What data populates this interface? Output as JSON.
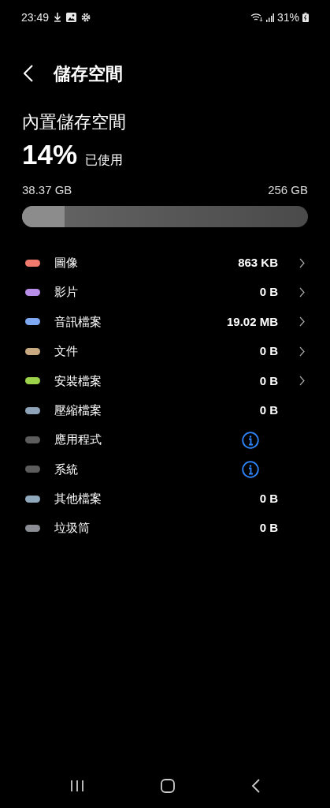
{
  "status_bar": {
    "time": "23:49",
    "battery": "31%"
  },
  "header": {
    "title": "儲存空間"
  },
  "storage": {
    "title": "內置儲存空間",
    "percent": "14%",
    "percent_label": "已使用",
    "used": "38.37 GB",
    "total": "256 GB",
    "level": 0.15
  },
  "categories": [
    {
      "label": "圖像",
      "color": "#f07a6e",
      "kind": "size",
      "size": "863 KB",
      "chevron": true
    },
    {
      "label": "影片",
      "color": "#b98ee8",
      "kind": "size",
      "size": "0 B",
      "chevron": true
    },
    {
      "label": "音訊檔案",
      "color": "#7fa8f2",
      "kind": "size",
      "size": "19.02 MB",
      "chevron": true
    },
    {
      "label": "文件",
      "color": "#c8a982",
      "kind": "size",
      "size": "0 B",
      "chevron": true
    },
    {
      "label": "安裝檔案",
      "color": "#9dd34a",
      "kind": "size",
      "size": "0 B",
      "chevron": true
    },
    {
      "label": "壓縮檔案",
      "color": "#8fa3b8",
      "kind": "size",
      "size": "0 B",
      "chevron": false
    },
    {
      "label": "應用程式",
      "color": "#5c5c5c",
      "kind": "info"
    },
    {
      "label": "系統",
      "color": "#5c5c5c",
      "kind": "info"
    },
    {
      "label": "其他檔案",
      "color": "#8fa8bb",
      "kind": "size",
      "size": "0 B",
      "chevron": false
    },
    {
      "label": "垃圾筒",
      "color": "#8a8d94",
      "kind": "size",
      "size": "0 B",
      "chevron": false
    }
  ]
}
